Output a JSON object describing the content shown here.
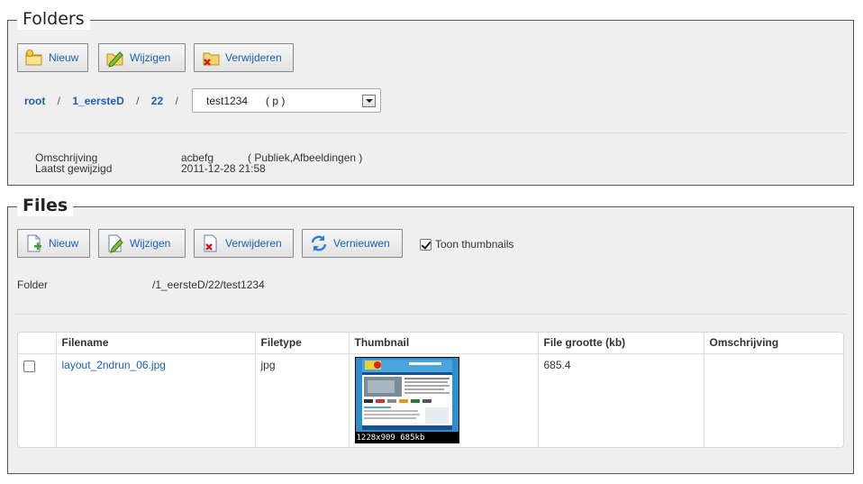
{
  "folders": {
    "legend": "Folders",
    "buttons": {
      "new": "Nieuw",
      "edit": "Wijzigen",
      "delete": "Verwijderen"
    },
    "breadcrumb": [
      {
        "label": "root"
      },
      {
        "label": "1_eersteD"
      },
      {
        "label": "22"
      }
    ],
    "separator": "/",
    "select_value": "test1234      ( p )",
    "info": {
      "description_label": "Omschrijving",
      "description_value": "acbefg",
      "description_tags": "( Publiek,Afbeeldingen )",
      "modified_label": "Laatst gewijzigd",
      "modified_value": "2011-12-28 21:58"
    }
  },
  "files": {
    "legend": "Files",
    "buttons": {
      "new": "Nieuw",
      "edit": "Wijzigen",
      "delete": "Verwijderen",
      "refresh": "Vernieuwen"
    },
    "show_thumbnails_label": "Toon thumbnails",
    "show_thumbnails_checked": true,
    "folder_label": "Folder",
    "folder_path": "/1_eersteD/22/test1234",
    "table": {
      "headers": [
        "",
        "Filename",
        "Filetype",
        "Thumbnail",
        "File grootte (kb)",
        "Omschrijving"
      ],
      "rows": [
        {
          "checked": false,
          "filename": "layout_2ndrun_06.jpg",
          "filetype": "jpg",
          "thumbnail_caption": "1228x909 685kb",
          "size": "685.4",
          "description": ""
        }
      ]
    }
  },
  "colors": {
    "link": "#1a5fb4",
    "panel_bg": "#efefef",
    "border": "#555555"
  }
}
